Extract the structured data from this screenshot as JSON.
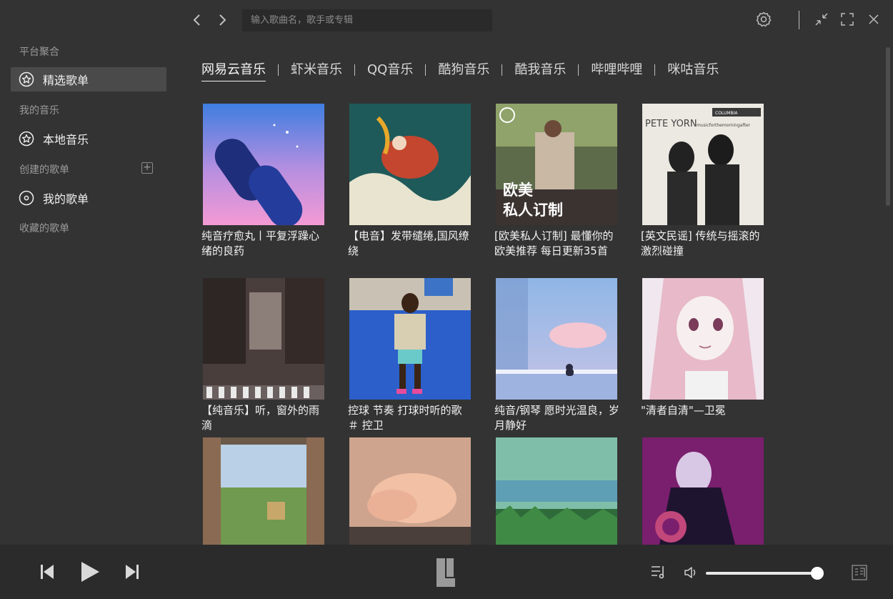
{
  "search": {
    "placeholder": "输入歌曲名，歌手或专辑"
  },
  "icons": {
    "back": "chevron-left-icon",
    "forward": "chevron-right-icon",
    "settings": "gear-icon",
    "minimize": "collapse-icon",
    "maximize": "fullscreen-icon",
    "close": "close-icon"
  },
  "sidebar": {
    "section_platform": "平台聚合",
    "item_featured": "精选歌单",
    "section_my_music": "我的音乐",
    "item_local": "本地音乐",
    "section_created": "创建的歌单",
    "item_my_playlist": "我的歌单",
    "section_collected": "收藏的歌单"
  },
  "tabs": [
    {
      "label": "网易云音乐",
      "active": true
    },
    {
      "label": "虾米音乐",
      "active": false
    },
    {
      "label": "QQ音乐",
      "active": false
    },
    {
      "label": "酷狗音乐",
      "active": false
    },
    {
      "label": "酷我音乐",
      "active": false
    },
    {
      "label": "哔哩哔哩",
      "active": false
    },
    {
      "label": "咪咕音乐",
      "active": false
    }
  ],
  "playlists": [
    {
      "title": "纯音疗愈丸丨平复浮躁心绪的良药"
    },
    {
      "title": "【电音】发带缱绻,国风缭绕"
    },
    {
      "title": "[欧美私人订制] 最懂你的欧美推荐 每日更新35首",
      "cover_text_1": "欧美",
      "cover_text_2": "私人订制"
    },
    {
      "title": "[英文民谣] 传统与摇滚的激烈碰撞",
      "cover_text_1": "PETE YORN",
      "cover_text_2": "musicforthemorningafter",
      "cover_label": "COLUMBIA"
    },
    {
      "title": "【纯音乐】听，窗外的雨滴"
    },
    {
      "title": "控球 节奏 打球时听的歌 ＃ 控卫"
    },
    {
      "title": "纯音/钢琴 愿时光温良，岁月静好"
    },
    {
      "title": "\"清者自清\"—卫冕"
    },
    {
      "title": ""
    },
    {
      "title": ""
    },
    {
      "title": ""
    },
    {
      "title": ""
    }
  ],
  "player": {
    "prev": "skip-previous-icon",
    "play": "play-icon",
    "next": "skip-next-icon",
    "logo": "app-logo",
    "playlist": "playlist-icon",
    "volume_icon": "volume-icon",
    "volume_level": 0.95,
    "lyrics": "lyrics-icon"
  },
  "colors": {
    "background": "#333333",
    "sidebar_active": "#4a4a4a",
    "player_bg": "#2b2b2b"
  }
}
